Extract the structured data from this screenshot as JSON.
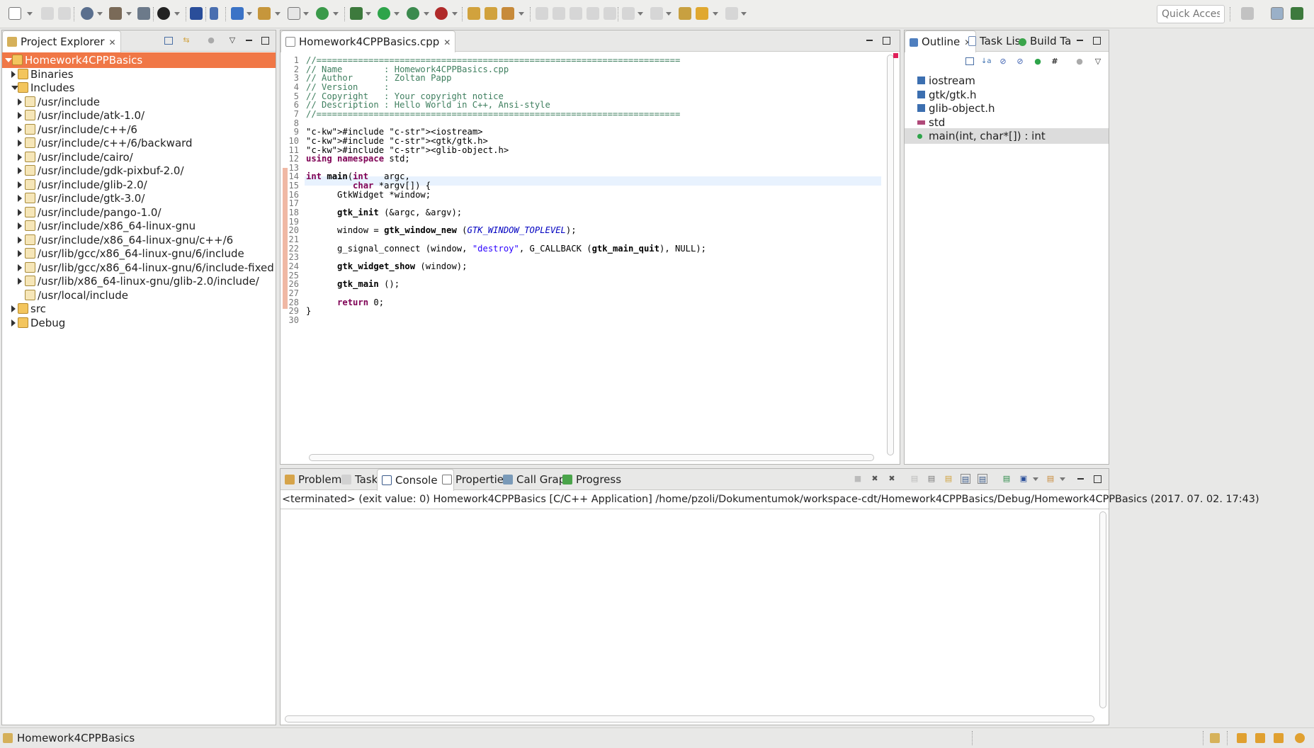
{
  "toolbar": {
    "quick_access_placeholder": "Quick Access"
  },
  "project_explorer": {
    "tab_label": "Project Explorer",
    "tree": [
      {
        "label": "Homework4CPPBasics",
        "expanded": true,
        "selected": true
      },
      {
        "label": "Binaries",
        "expanded": false
      },
      {
        "label": "Includes",
        "expanded": true
      },
      {
        "label": "/usr/include"
      },
      {
        "label": "/usr/include/atk-1.0/"
      },
      {
        "label": "/usr/include/c++/6"
      },
      {
        "label": "/usr/include/c++/6/backward"
      },
      {
        "label": "/usr/include/cairo/"
      },
      {
        "label": "/usr/include/gdk-pixbuf-2.0/"
      },
      {
        "label": "/usr/include/glib-2.0/"
      },
      {
        "label": "/usr/include/gtk-3.0/"
      },
      {
        "label": "/usr/include/pango-1.0/"
      },
      {
        "label": "/usr/include/x86_64-linux-gnu"
      },
      {
        "label": "/usr/include/x86_64-linux-gnu/c++/6"
      },
      {
        "label": "/usr/lib/gcc/x86_64-linux-gnu/6/include"
      },
      {
        "label": "/usr/lib/gcc/x86_64-linux-gnu/6/include-fixed"
      },
      {
        "label": "/usr/lib/x86_64-linux-gnu/glib-2.0/include/"
      },
      {
        "label": "/usr/local/include"
      },
      {
        "label": "src",
        "expanded": false
      },
      {
        "label": "Debug",
        "expanded": false
      }
    ]
  },
  "editor": {
    "tab_label": "Homework4CPPBasics.cpp",
    "line_numbers": [
      "1",
      "2",
      "3",
      "4",
      "5",
      "6",
      "7",
      "8",
      "9",
      "10",
      "11",
      "12",
      "13",
      "14",
      "15",
      "16",
      "17",
      "18",
      "19",
      "20",
      "21",
      "22",
      "23",
      "24",
      "25",
      "26",
      "27",
      "28",
      "29",
      "30"
    ],
    "lines": [
      "//======================================================================",
      "// Name        : Homework4CPPBasics.cpp",
      "// Author      : Zoltan Papp",
      "// Version     :",
      "// Copyright   : Your copyright notice",
      "// Description : Hello World in C++, Ansi-style",
      "//======================================================================",
      "",
      "#include <iostream>",
      "#include <gtk/gtk.h>",
      "#include <glib-object.h>",
      "using namespace std;",
      "",
      "int main(int   argc,",
      "         char *argv[]) {",
      "      GtkWidget *window;",
      "",
      "      gtk_init (&argc, &argv);",
      "",
      "      window = gtk_window_new (GTK_WINDOW_TOPLEVEL);",
      "",
      "      g_signal_connect (window, \"destroy\", G_CALLBACK (gtk_main_quit), NULL);",
      "",
      "      gtk_widget_show (window);",
      "",
      "      gtk_main ();",
      "",
      "      return 0;",
      "}",
      ""
    ]
  },
  "outline": {
    "tabs": [
      "Outline",
      "Task Lis",
      "Build Ta"
    ],
    "items": [
      {
        "label": "iostream",
        "kind": "include"
      },
      {
        "label": "gtk/gtk.h",
        "kind": "include"
      },
      {
        "label": "glib-object.h",
        "kind": "include"
      },
      {
        "label": "std",
        "kind": "namespace"
      },
      {
        "label": "main(int, char*[]) : int",
        "kind": "function",
        "selected": true
      }
    ]
  },
  "bottom": {
    "tabs": [
      "Problems",
      "Tasks",
      "Console",
      "Properties",
      "Call Graph",
      "Progress"
    ],
    "active_tab": "Console",
    "console_header": "<terminated> (exit value: 0) Homework4CPPBasics [C/C++ Application] /home/pzoli/Dokumentumok/workspace-cdt/Homework4CPPBasics/Debug/Homework4CPPBasics (2017. 07. 02. 17:43)"
  },
  "status": {
    "selected_item": "Homework4CPPBasics"
  },
  "colors": {
    "selection": "#f07746",
    "outline_selection": "#dcdcdc",
    "current_line": "#e8f2fe"
  }
}
